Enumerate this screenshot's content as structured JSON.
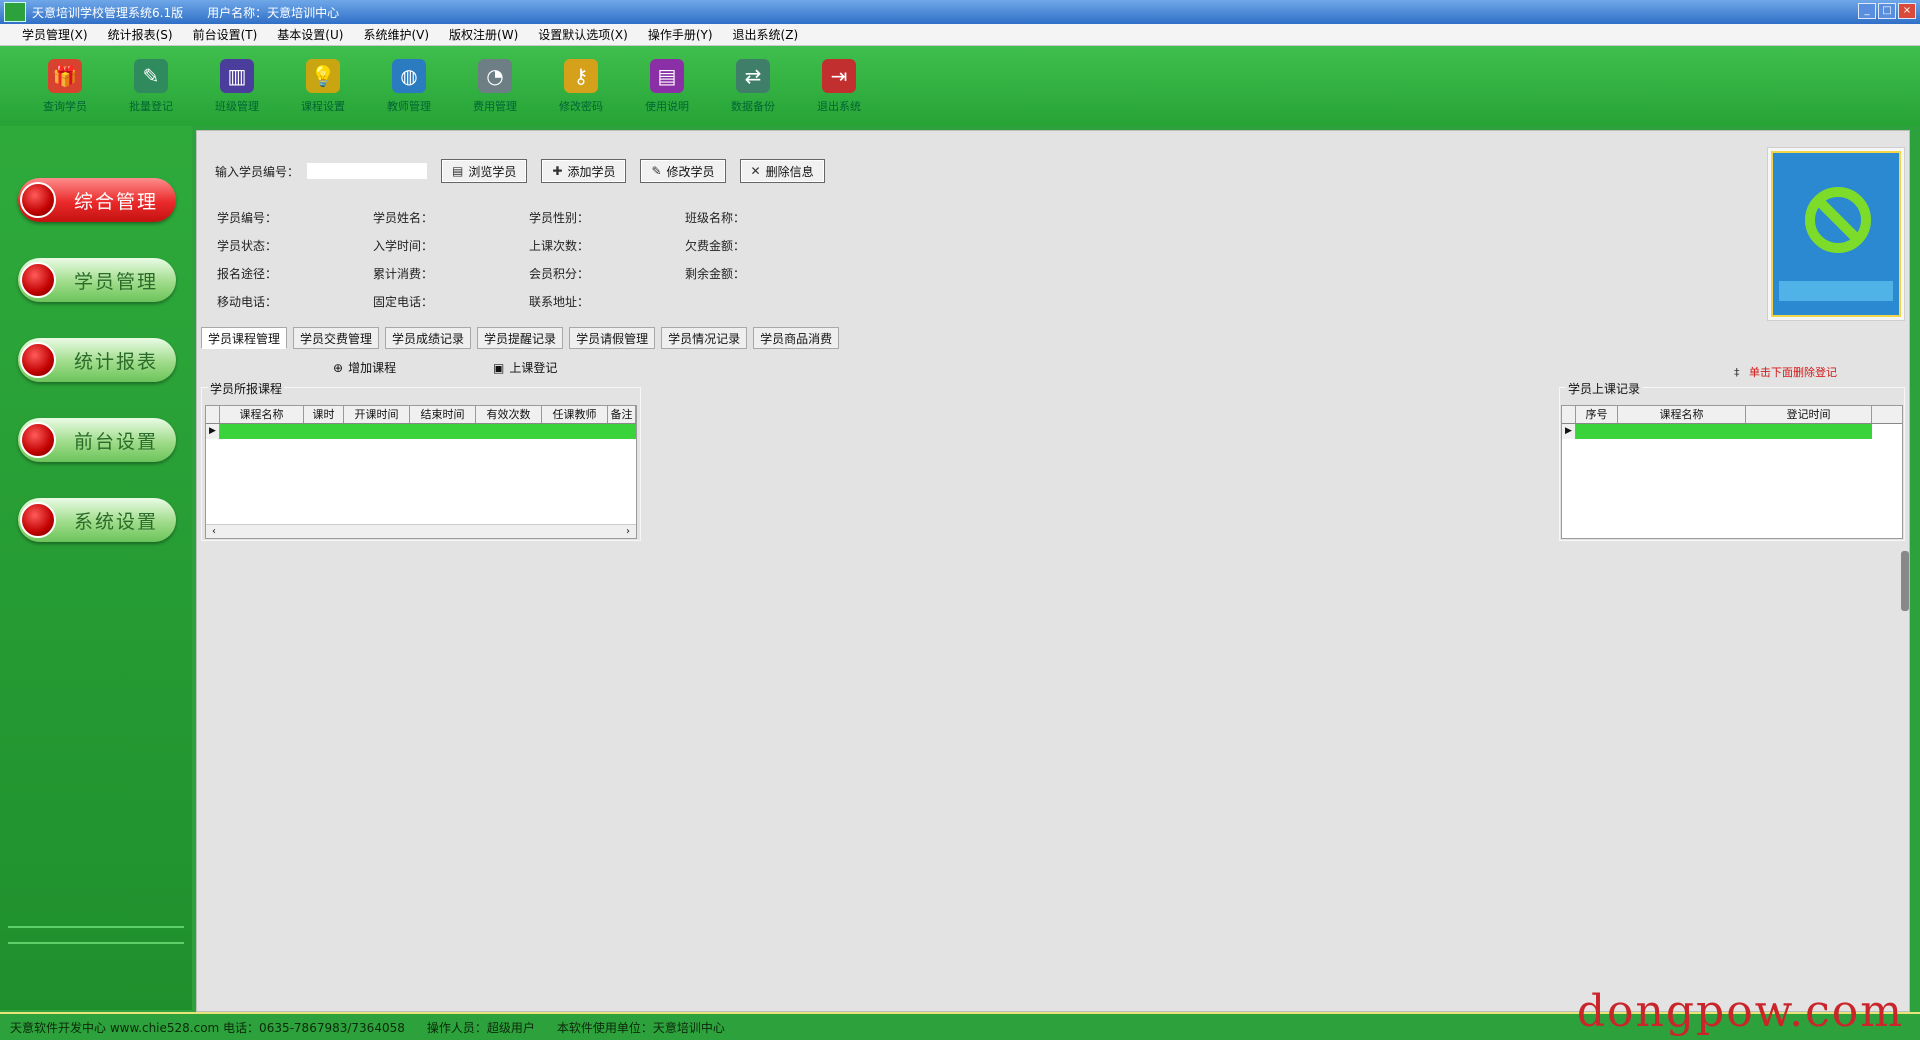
{
  "window": {
    "title": "天意培训学校管理系统6.1版",
    "user_label": "用户名称：天意培训中心"
  },
  "menu": [
    "学员管理(X)",
    "统计报表(S)",
    "前台设置(T)",
    "基本设置(U)",
    "系统维护(V)",
    "版权注册(W)",
    "设置默认选项(X)",
    "操作手册(Y)",
    "退出系统(Z)"
  ],
  "toolbar": [
    {
      "label": "查询学员",
      "icon": "gift-icon",
      "color": "#d8432f",
      "glyph": "🎁"
    },
    {
      "label": "批量登记",
      "icon": "pen-icon",
      "color": "#2f8a5d",
      "glyph": "✎"
    },
    {
      "label": "班级管理",
      "icon": "book-icon",
      "color": "#4a3d9c",
      "glyph": "▥"
    },
    {
      "label": "课程设置",
      "icon": "lightbulb-icon",
      "color": "#c9a512",
      "glyph": "💡"
    },
    {
      "label": "教师管理",
      "icon": "globe-icon",
      "color": "#2a7bbf",
      "glyph": "◍"
    },
    {
      "label": "费用管理",
      "icon": "chart-icon",
      "color": "#6d7f85",
      "glyph": "◔"
    },
    {
      "label": "修改密码",
      "icon": "key-icon",
      "color": "#d5a01a",
      "glyph": "⚷"
    },
    {
      "label": "使用说明",
      "icon": "books-icon",
      "color": "#8b2fa7",
      "glyph": "▤"
    },
    {
      "label": "数据备份",
      "icon": "handshake-icon",
      "color": "#3f7f6a",
      "glyph": "⇄"
    },
    {
      "label": "退出系统",
      "icon": "exit-door-icon",
      "color": "#c12f2f",
      "glyph": "⇥"
    }
  ],
  "sidebar": [
    {
      "label": "综合管理",
      "active": true
    },
    {
      "label": "学员管理",
      "active": false
    },
    {
      "label": "统计报表",
      "active": false
    },
    {
      "label": "前台设置",
      "active": false
    },
    {
      "label": "系统设置",
      "active": false
    }
  ],
  "search": {
    "label": "输入学员编号：",
    "value": "",
    "buttons": [
      "浏览学员",
      "添加学员",
      "修改学员",
      "删除信息"
    ]
  },
  "info_fields": [
    "学员编号：",
    "学员姓名：",
    "学员性别：",
    "班级名称：",
    "学员状态：",
    "入学时间：",
    "上课次数：",
    "欠费金额：",
    "报名途径：",
    "累计消费：",
    "会员积分：",
    "剩余金额：",
    "移动电话：",
    "固定电话：",
    "联系地址："
  ],
  "tabs": [
    "学员课程管理",
    "学员交费管理",
    "学员成绩记录",
    "学员提醒记录",
    "学员请假管理",
    "学员情况记录",
    "学员商品消费"
  ],
  "actions": {
    "add_course": "增加课程",
    "checkin": "上课登记",
    "hint": "单击下面删除登记"
  },
  "course_group": {
    "title": "学员所报课程",
    "columns": [
      "课程名称",
      "课时",
      "开课时间",
      "结束时间",
      "有效次数",
      "任课教师",
      "备注"
    ]
  },
  "record_group": {
    "title": "学员上课记录",
    "columns": [
      "序号",
      "课程名称",
      "登记时间"
    ]
  },
  "status": {
    "developer": "天意软件开发中心 www.chie528.com 电话：0635-7867983/7364058",
    "operator": "操作人员：超级用户",
    "licensee": "本软件使用单位：天意培训中心"
  },
  "watermark": "dongpow.com"
}
